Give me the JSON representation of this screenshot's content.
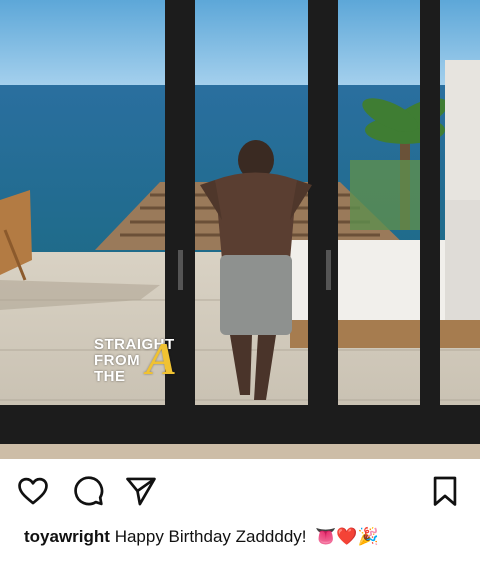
{
  "post": {
    "watermark_lines": [
      "STRAIGHT",
      "FROM",
      "THE"
    ],
    "watermark_letter": "A"
  },
  "actions": {
    "like_icon": "heart-outline-icon",
    "comment_icon": "comment-bubble-icon",
    "share_icon": "paper-plane-icon",
    "save_icon": "bookmark-icon"
  },
  "caption": {
    "username": "toyawright",
    "text": "Happy Birthday Zaddddy!",
    "emojis": "👅❤️🎉"
  }
}
